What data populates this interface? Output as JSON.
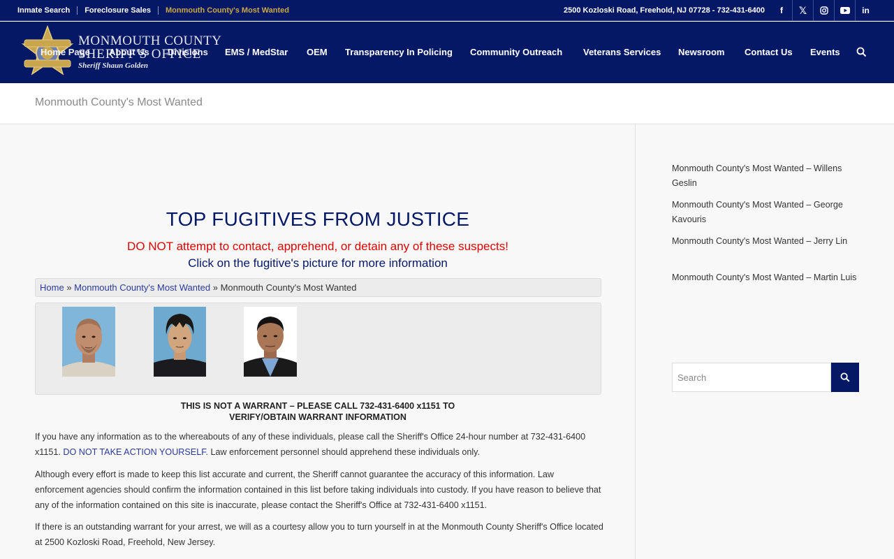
{
  "topbar": {
    "links": [
      "Inmate Search",
      "Foreclosure Sales",
      "Monmouth County's Most Wanted"
    ],
    "address": "2500 Kozloski Road, Freehold, NJ 07728 - 732-431-6400",
    "social": [
      "facebook-icon",
      "x-twitter-icon",
      "instagram-icon",
      "youtube-icon",
      "linkedin-icon"
    ]
  },
  "logo": {
    "line1": "MONMOUTH COUNTY",
    "line2": "SHERIFF'S OFFICE",
    "line3": "Sheriff Shaun Golden"
  },
  "nav": {
    "items": [
      "Home Page",
      "About Us",
      "Divisions",
      "EMS / MedStar",
      "OEM",
      "Transparency In Policing",
      "Community Outreach",
      "Veterans Services",
      "Newsroom",
      "Contact Us",
      "Events"
    ]
  },
  "page": {
    "title": "Monmouth County's Most Wanted"
  },
  "main": {
    "heading": "TOP FUGITIVES FROM JUSTICE",
    "warning": "DO NOT attempt to contact, apprehend, or detain any of these suspects!",
    "instruction": "Click on the fugitive's picture for more information",
    "breadcrumb": {
      "home": "Home",
      "sep": "»",
      "parent": "Monmouth County's Most Wanted",
      "current": "Monmouth County's Most Wanted"
    },
    "warrant_notice": "THIS IS NOT A WARRANT – PLEASE CALL 732-431-6400 x1151 TO VERIFY/OBTAIN WARRANT INFORMATION",
    "para1_a": "If you have any information as to the whereabouts of any of these individuals, please call the Sheriff's Office 24-hour number at 732-431-6400 x1151.",
    "para1_b": "DO NOT TAKE ACTION YOURSELF.",
    "para1_c": "Law enforcement personnel should apprehend these individuals only.",
    "para2": "Although every effort is made to keep this list accurate and current, the Sheriff cannot guarantee the accuracy of this information. Law enforcement agencies should confirm the information contained in this list before taking individuals into custody. If you have reason to believe that any of the information contained on this site is inaccurate, please contact the Sheriff's Office at 732-431-6400 x1151.",
    "para3": "If there is an outstanding warrant for your arrest, we will as a courtesy allow you to turn yourself in at the Monmouth County Sheriff's Office located at 2500 Kozloski Road, Freehold, New Jersey."
  },
  "sidebar": {
    "links": [
      "Monmouth County's Most Wanted – Willens Geslin",
      "Monmouth County's Most Wanted – George Kavouris",
      "Monmouth County's Most Wanted – Jerry Lin",
      "Monmouth County's Most Wanted – Martin Luis"
    ],
    "search_placeholder": "Search"
  },
  "colors": {
    "header_navy": "#051866",
    "accent_gold": "#c9a84a",
    "warning_red": "#e00000"
  }
}
